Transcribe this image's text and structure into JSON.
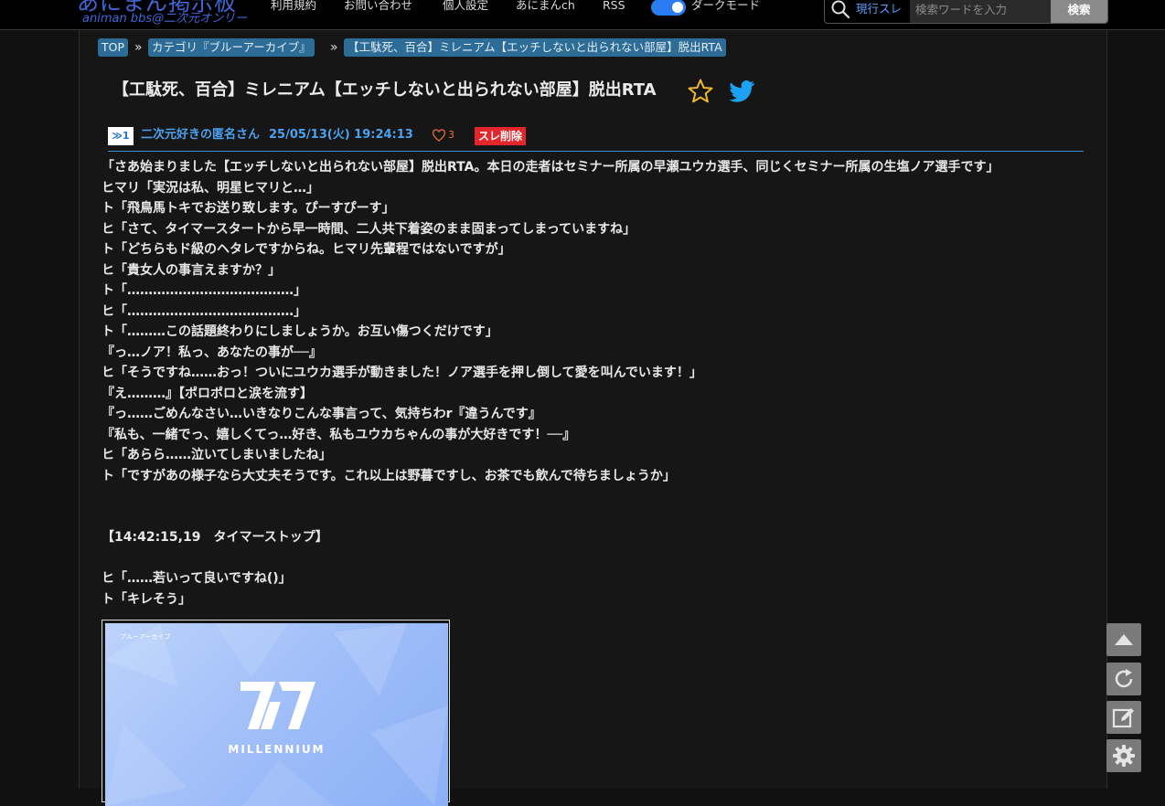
{
  "header": {
    "logo_title": "あにまん掲示板",
    "logo_subtitle": "animan bbs@二次元オンリー",
    "nav": [
      {
        "label": "利用規約"
      },
      {
        "label": "お問い合わせ"
      },
      {
        "label": "個人設定"
      },
      {
        "label": "あにまんch"
      },
      {
        "label": "RSS"
      }
    ],
    "dark_mode_label": "ダークモード",
    "dark_mode_on": true,
    "search": {
      "scope": "現行スレ",
      "placeholder": "検索ワードを入力",
      "button_label": "検索"
    },
    "colors": {
      "accent": "#2a7cf0",
      "logo": "#3f67d8"
    }
  },
  "breadcrumb": {
    "items": [
      "TOP",
      "カテゴリ『ブルーアーカイブ』",
      "【工駄死、百合】ミレニアム【エッチしないと出られない部屋】脱出RTA"
    ],
    "separator": "»"
  },
  "thread": {
    "title": "【工駄死、百合】ミレニアム【エッチしないと出られない部屋】脱出RTA",
    "favorite_icon": "star-outline-icon",
    "share_icon": "twitter-icon"
  },
  "post": {
    "number": "≫1",
    "name": "二次元好きの匿名さん",
    "date": "25/05/13(火) 19:24:13",
    "likes": "3",
    "delete_label": "スレ削除",
    "lines": [
      "「さあ始まりました【エッチしないと出られない部屋】脱出RTA。本日の走者はセミナー所属の早瀬ユウカ選手、同じくセミナー所属の生塩ノア選手です」",
      "ヒマリ「実況は私、明星ヒマリと…」",
      "ト「飛鳥馬トキでお送り致します。ぴーすぴーす」",
      "ヒ「さて、タイマースタートから早一時間、二人共下着姿のまま固まってしまっていますね」",
      "ト「どちらもド級のヘタレですからね。ヒマリ先輩程ではないですが」",
      "ヒ「貴女人の事言えますか？」",
      "ト「…………………………………」",
      "ヒ「…………………………………」",
      "ト「………この話題終わりにしましょうか。お互い傷つくだけです」",
      "『っ…ノア！私っ、あなたの事が──』",
      "ヒ「そうですね……おっ！ついにユウカ選手が動きました！ノア選手を押し倒して愛を叫んでいます！」",
      "『え………』【ポロポロと涙を流す】",
      "『っ……ごめんなさい…いきなりこんな事言って、気持ちわr『違うんです』",
      "『私も、一緒でっ、嬉しくてっ…好き、私もユウカちゃんの事が大好きです！──』",
      "ヒ「あらら……泣いてしまいましたね」",
      "ト「ですがあの様子なら大丈夫そうです。これ以上は野暮ですし、お茶でも飲んで待ちましょうか」",
      "",
      "",
      "【14:42:15,19　タイマーストップ】",
      "",
      "ヒ「……若いって良いですね()」",
      "ト「キレそう」"
    ],
    "image": {
      "caption": "MILLENNIUM",
      "top_label": "ブルーアーカイブ"
    }
  },
  "side_buttons": [
    {
      "name": "scroll-top-button",
      "icon": "triangle-up-icon"
    },
    {
      "name": "reload-button",
      "icon": "reload-icon"
    },
    {
      "name": "write-button",
      "icon": "edit-icon"
    },
    {
      "name": "settings-button",
      "icon": "gear-icon"
    }
  ]
}
